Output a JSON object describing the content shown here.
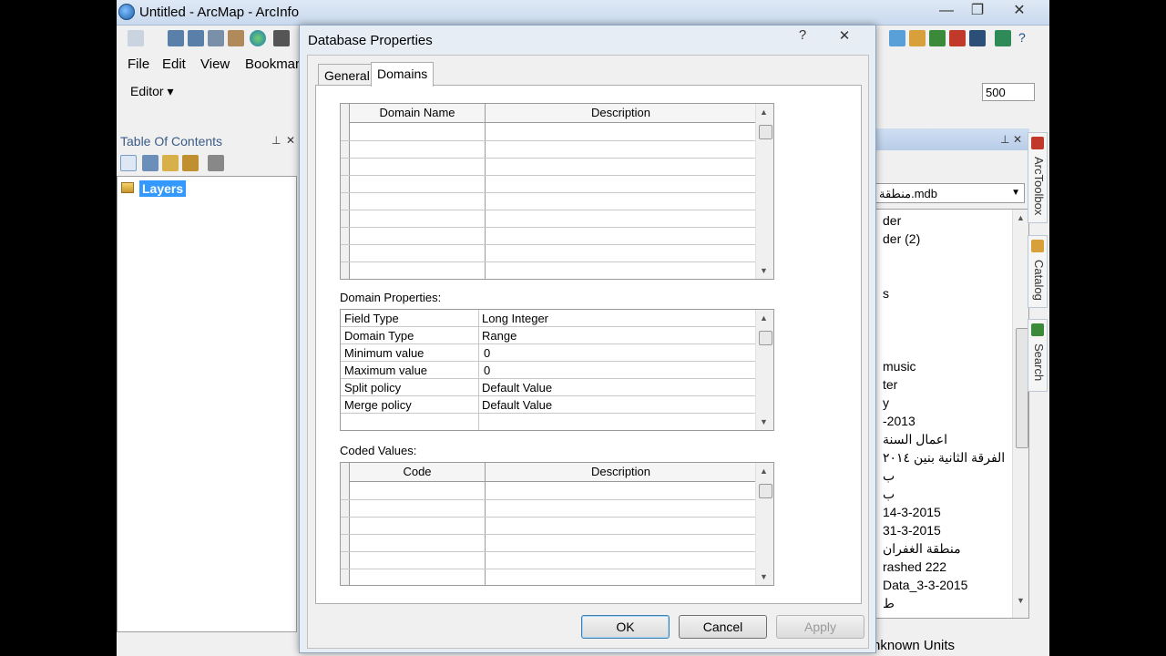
{
  "window": {
    "title": "Untitled - ArcMap - ArcInfo",
    "min_glyph": "—",
    "max_glyph": "❐",
    "close_glyph": "✕"
  },
  "menu": [
    "File",
    "Edit",
    "View",
    "Bookmar"
  ],
  "editor": {
    "label": "Editor ▾",
    "scale_value": "500"
  },
  "toc": {
    "title": "Table Of Contents",
    "pin_glyph": "⊥",
    "close_glyph": "✕",
    "root_layer": "Layers"
  },
  "catalog": {
    "location": "منطقة.mdb",
    "items": [
      "der",
      "der (2)",
      "s",
      "music",
      "ter",
      "y",
      "-2013",
      "اعمال السنة",
      "الفرقة الثانية بنين ٢٠١٤",
      "ب",
      "ب",
      "14-3-2015",
      "31-3-2015",
      "منطقة الغفران",
      "rashed 222",
      "Data_3-3-2015",
      "ط"
    ],
    "pin_glyph": "⊥",
    "close_glyph": "✕"
  },
  "side_tabs": [
    "ArcToolbox",
    "Catalog",
    "Search"
  ],
  "status": {
    "units": "nknown Units"
  },
  "dialog": {
    "title": "Database Properties",
    "help_glyph": "?",
    "close_glyph": "✕",
    "tabs": [
      "General",
      "Domains"
    ],
    "domains_grid": {
      "col_name": "Domain Name",
      "col_desc": "Description"
    },
    "domain_properties_label": "Domain Properties:",
    "properties": [
      {
        "name": "Field Type",
        "value": "Long Integer"
      },
      {
        "name": "Domain Type",
        "value": "Range"
      },
      {
        "name": "Minimum value",
        "value": "0"
      },
      {
        "name": "Maximum value",
        "value": "0"
      },
      {
        "name": "Split policy",
        "value": "Default Value"
      },
      {
        "name": "Merge policy",
        "value": "Default Value"
      }
    ],
    "coded_values_label": "Coded Values:",
    "coded_grid": {
      "col_code": "Code",
      "col_desc": "Description"
    },
    "buttons": {
      "ok": "OK",
      "cancel": "Cancel",
      "apply": "Apply"
    }
  }
}
